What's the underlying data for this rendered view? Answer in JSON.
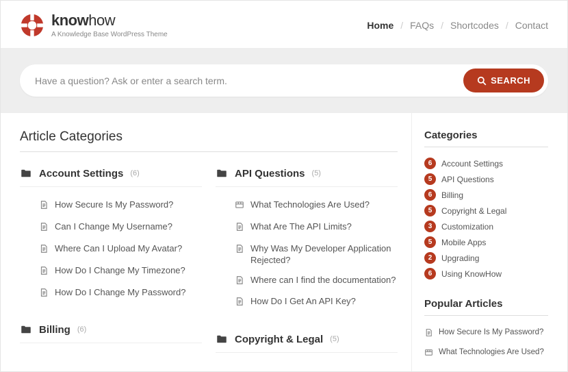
{
  "brand": {
    "name_bold": "know",
    "name_light": "how",
    "tagline": "A Knowledge Base WordPress Theme"
  },
  "nav": {
    "home": "Home",
    "faqs": "FAQs",
    "shortcodes": "Shortcodes",
    "contact": "Contact"
  },
  "search": {
    "placeholder": "Have a question? Ask or enter a search term.",
    "button": "SEARCH"
  },
  "main_title": "Article Categories",
  "categories": [
    {
      "name": "Account Settings",
      "count": "(6)",
      "articles": [
        {
          "icon": "doc",
          "t": "How Secure Is My Password?"
        },
        {
          "icon": "doc",
          "t": "Can I Change My Username?"
        },
        {
          "icon": "doc",
          "t": "Where Can I Upload My Avatar?"
        },
        {
          "icon": "doc",
          "t": "How Do I Change My Timezone?"
        },
        {
          "icon": "doc",
          "t": "How Do I Change My Password?"
        }
      ]
    },
    {
      "name": "API Questions",
      "count": "(5)",
      "articles": [
        {
          "icon": "video",
          "t": "What Technologies Are Used?"
        },
        {
          "icon": "doc",
          "t": "What Are The API Limits?"
        },
        {
          "icon": "doc",
          "t": "Why Was My Developer Application Rejected?"
        },
        {
          "icon": "doc",
          "t": "Where can I find the documentation?"
        },
        {
          "icon": "doc",
          "t": "How Do I Get An API Key?"
        }
      ]
    },
    {
      "name": "Billing",
      "count": "(6)",
      "articles": []
    },
    {
      "name": "Copyright & Legal",
      "count": "(5)",
      "articles": []
    }
  ],
  "sidebar": {
    "cat_title": "Categories",
    "cats": [
      {
        "n": "6",
        "l": "Account Settings"
      },
      {
        "n": "5",
        "l": "API Questions"
      },
      {
        "n": "6",
        "l": "Billing"
      },
      {
        "n": "5",
        "l": "Copyright & Legal"
      },
      {
        "n": "3",
        "l": "Customization"
      },
      {
        "n": "5",
        "l": "Mobile Apps"
      },
      {
        "n": "2",
        "l": "Upgrading"
      },
      {
        "n": "6",
        "l": "Using KnowHow"
      }
    ],
    "pop_title": "Popular Articles",
    "pop": [
      {
        "icon": "doc",
        "t": "How Secure Is My Password?"
      },
      {
        "icon": "video",
        "t": "What Technologies Are Used?"
      }
    ]
  }
}
